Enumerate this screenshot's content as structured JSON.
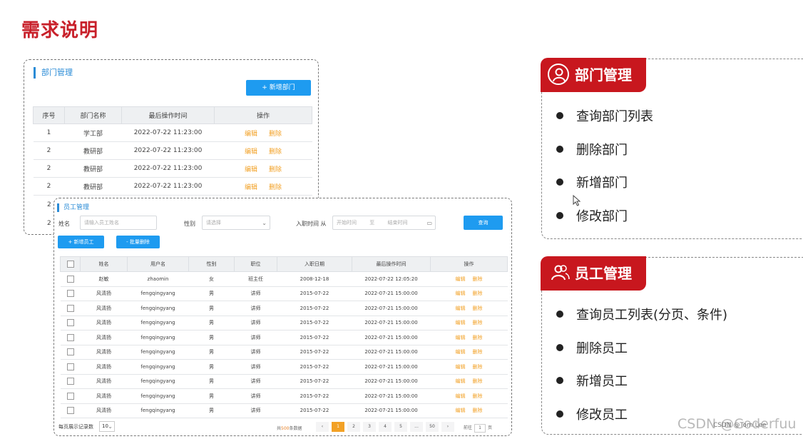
{
  "page": {
    "title": "需求说明"
  },
  "dept_panel": {
    "title": "部门管理",
    "add_button": "+ 新增部门",
    "columns": [
      "序号",
      "部门名称",
      "最后操作时间",
      "操作"
    ],
    "edit_label": "编辑",
    "delete_label": "删除",
    "rows": [
      {
        "no": "1",
        "name": "学工部",
        "time": "2022-07-22 11:23:00"
      },
      {
        "no": "2",
        "name": "教研部",
        "time": "2022-07-22 11:23:00"
      },
      {
        "no": "2",
        "name": "教研部",
        "time": "2022-07-22 11:23:00"
      },
      {
        "no": "2",
        "name": "教研部",
        "time": "2022-07-22 11:23:00"
      }
    ],
    "hidden_row_nos": [
      "2",
      "2"
    ]
  },
  "emp_panel": {
    "title": "员工管理",
    "name_label": "姓名",
    "name_placeholder": "请输入员工姓名",
    "gender_label": "性别",
    "gender_placeholder": "请选择",
    "date_label": "入职时间 从",
    "date_start": "开始时间",
    "date_to": "至",
    "date_end": "结束时间",
    "query_button": "查询",
    "add_button": "+ 新增员工",
    "batch_delete_button": "- 批量删除",
    "columns": [
      "姓名",
      "用户名",
      "性别",
      "职位",
      "入职日期",
      "最后操作时间",
      "操作"
    ],
    "edit_label": "编辑",
    "delete_label": "删除",
    "rows": [
      {
        "name": "赵敏",
        "username": "zhaomin",
        "gender": "女",
        "position": "班主任",
        "entry": "2008-12-18",
        "time": "2022-07-22 12:05:20"
      },
      {
        "name": "风清扬",
        "username": "fengqingyang",
        "gender": "男",
        "position": "讲师",
        "entry": "2015-07-22",
        "time": "2022-07-21 15:00:00"
      },
      {
        "name": "风清扬",
        "username": "fengqingyang",
        "gender": "男",
        "position": "讲师",
        "entry": "2015-07-22",
        "time": "2022-07-21 15:00:00"
      },
      {
        "name": "风清扬",
        "username": "fengqingyang",
        "gender": "男",
        "position": "讲师",
        "entry": "2015-07-22",
        "time": "2022-07-21 15:00:00"
      },
      {
        "name": "风清扬",
        "username": "fengqingyang",
        "gender": "男",
        "position": "讲师",
        "entry": "2015-07-22",
        "time": "2022-07-21 15:00:00"
      },
      {
        "name": "风清扬",
        "username": "fengqingyang",
        "gender": "男",
        "position": "讲师",
        "entry": "2015-07-22",
        "time": "2022-07-21 15:00:00"
      },
      {
        "name": "风清扬",
        "username": "fengqingyang",
        "gender": "男",
        "position": "讲师",
        "entry": "2015-07-22",
        "time": "2022-07-21 15:00:00"
      },
      {
        "name": "风清扬",
        "username": "fengqingyang",
        "gender": "男",
        "position": "讲师",
        "entry": "2015-07-22",
        "time": "2022-07-21 15:00:00"
      },
      {
        "name": "风清扬",
        "username": "fengqingyang",
        "gender": "男",
        "position": "讲师",
        "entry": "2015-07-22",
        "time": "2022-07-21 15:00:00"
      },
      {
        "name": "风清扬",
        "username": "fengqingyang",
        "gender": "男",
        "position": "讲师",
        "entry": "2015-07-22",
        "time": "2022-07-21 15:00:00"
      }
    ],
    "page_size_label": "每页展示记录数",
    "page_size": "10",
    "total_prefix": "共",
    "total_count": "500",
    "total_suffix": "条数据",
    "pages": [
      "‹",
      "1",
      "2",
      "3",
      "4",
      "5",
      "...",
      "50",
      "›"
    ],
    "active_page": "1",
    "goto_label": "前往",
    "goto_value": "1",
    "goto_suffix": "页"
  },
  "cards": [
    {
      "title": "部门管理",
      "icon": "user-circle-icon",
      "items": [
        "查询部门列表",
        "删除部门",
        "新增部门",
        "修改部门"
      ]
    },
    {
      "title": "员工管理",
      "icon": "users-group-icon",
      "items": [
        "查询员工列表(分页、条件)",
        "删除员工",
        "新增员工",
        "修改员工"
      ]
    }
  ],
  "watermark": {
    "text": "CSDN @Coderfuu",
    "small": "CSDN @Tom.Lee"
  },
  "colors": {
    "brand_red": "#c8171e",
    "title_red": "#c8202a",
    "link_orange": "#f2a126",
    "button_blue": "#1e9bf0"
  }
}
